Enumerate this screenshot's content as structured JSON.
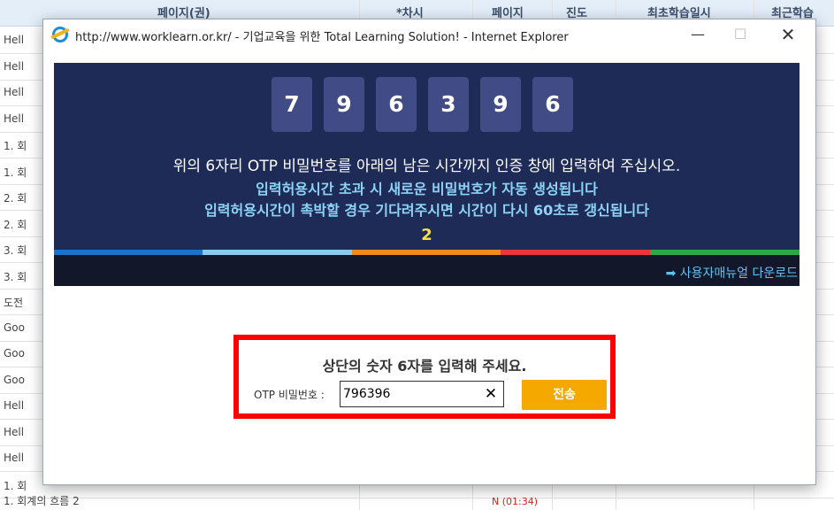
{
  "background": {
    "headers": [
      "페이지(권)",
      "*차시",
      "페이지",
      "진도",
      "최초학습일시",
      "최근학습"
    ],
    "rows": [
      "Hell",
      "Hell",
      "Hell",
      "Hell",
      "1. 회",
      "1. 회",
      "2. 회",
      "2. 회",
      "3. 회",
      "3. 회",
      "도전",
      "Goo",
      "Goo",
      "Goo",
      "Hell",
      "Hell",
      "Hell",
      "1. 회"
    ],
    "last_row": "1. 회계의 흐름 2",
    "last_status": "N (01:34)"
  },
  "window": {
    "title": "http://www.worklearn.or.kr/ - 기업교육을 위한 Total Learning Solution! - Internet Explorer",
    "minimize": "—",
    "maximize": "☐",
    "close": "✕"
  },
  "otp": {
    "digits": [
      "7",
      "9",
      "6",
      "3",
      "9",
      "6"
    ],
    "message_1": "위의 6자리 OTP 비밀번호를 아래의 남은 시간까지 인증 창에 입력하여 주십시오.",
    "message_2": "입력허용시간 초과 시 새로운 비밀번호가 자동 생성됩니다",
    "message_3": "입력허용시간이 촉박할 경우 기다려주시면 시간이 다시 60초로 갱신됩니다",
    "timer": "2",
    "manual_link": "➡ 사용자매뉴얼 다운로드",
    "prompt": "상단의 숫자 6자를 입력해 주세요.",
    "input_label": "OTP 비밀번호 :",
    "input_value": "796396",
    "clear_icon": "✕",
    "submit_label": "전송"
  },
  "colors": {
    "banner_bg": "#1f2b57",
    "digit_bg": "#414c86",
    "highlight_border": "#ff0000",
    "submit_bg": "#f5a800",
    "stripe": [
      "#1a73c9",
      "#8cc9ef",
      "#f08a1c",
      "#e8363c",
      "#2ba94a"
    ]
  }
}
